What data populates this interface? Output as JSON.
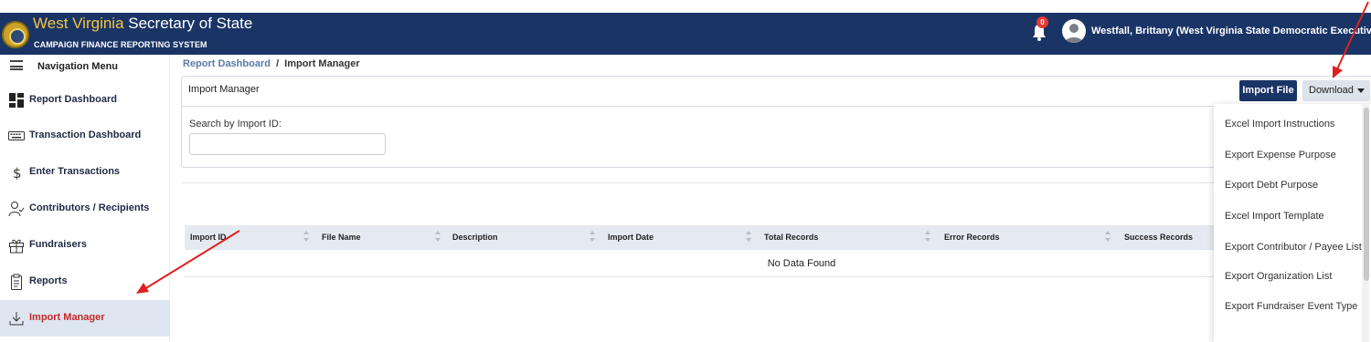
{
  "header": {
    "title_part1": "West Virginia",
    "title_part2": "Secretary of State",
    "subtitle": "CAMPAIGN FINANCE REPORTING SYSTEM",
    "notification_count": "0",
    "user_name": "Westfall, Brittany (West Virginia State Democratic Executive C"
  },
  "sidebar": {
    "title": "Navigation Menu",
    "items": [
      {
        "label": "Report Dashboard",
        "icon": "dashboard-icon"
      },
      {
        "label": "Transaction Dashboard",
        "icon": "keyboard-icon"
      },
      {
        "label": "Enter Transactions",
        "icon": "dollar-icon"
      },
      {
        "label": "Contributors / Recipients",
        "icon": "user-check-icon"
      },
      {
        "label": "Fundraisers",
        "icon": "gift-icon"
      },
      {
        "label": "Reports",
        "icon": "clipboard-icon"
      },
      {
        "label": "Import Manager",
        "icon": "download-icon"
      }
    ],
    "active_index": 6
  },
  "breadcrumb": {
    "parent": "Report Dashboard",
    "separator": "/",
    "current": "Import Manager"
  },
  "panel": {
    "title": "Import Manager",
    "search_label": "Search by Import ID:",
    "search_value": ""
  },
  "actions": {
    "import_label": "Import File",
    "download_label": "Download"
  },
  "table": {
    "columns": [
      "Import ID",
      "File Name",
      "Description",
      "Import Date",
      "Total Records",
      "Error Records",
      "Success Records"
    ],
    "empty_text": "No Data Found"
  },
  "dropdown": {
    "items": [
      "Excel Import Instructions",
      "Export Expense Purpose",
      "Export Debt Purpose",
      "Excel Import Template",
      "Export Contributor / Payee List",
      "Export Organization List",
      "Export Fundraiser Event Type"
    ]
  },
  "colors": {
    "header_bg": "#1a3466",
    "title_accent": "#f4c542",
    "active_label": "#c62828",
    "active_bg": "#dde6f0",
    "annotation_arrow": "#e02020"
  }
}
